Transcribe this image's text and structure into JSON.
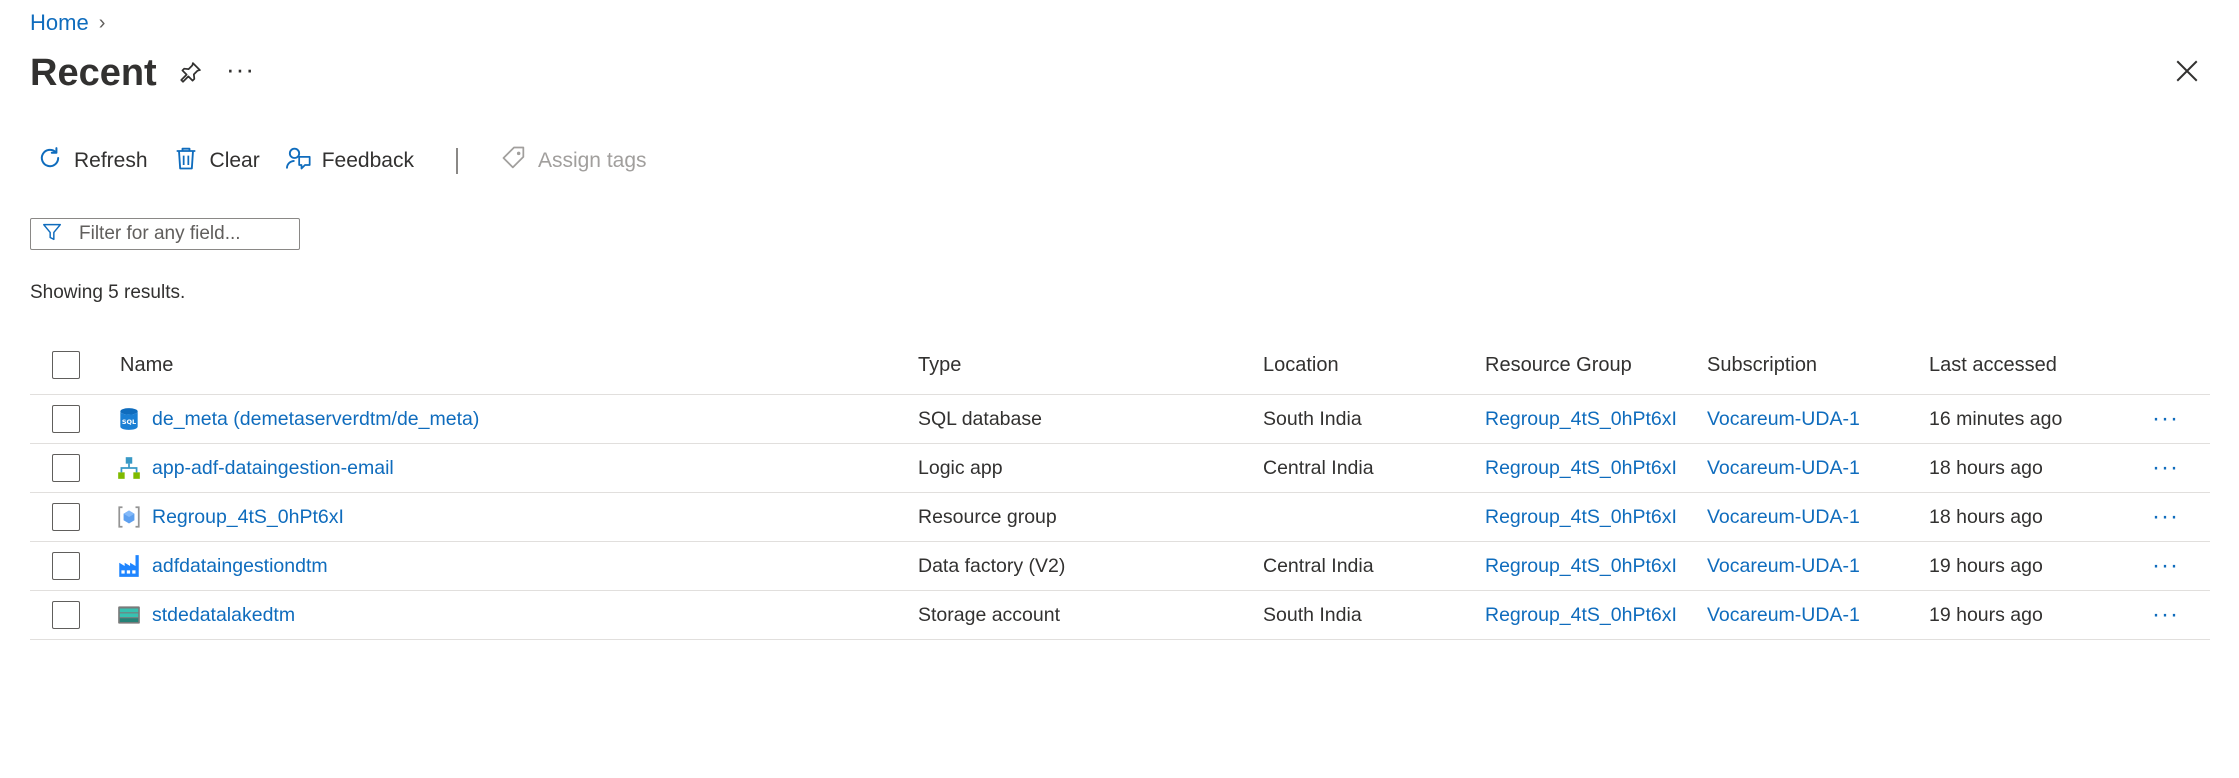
{
  "breadcrumb": {
    "home": "Home",
    "separator": "›"
  },
  "page": {
    "title": "Recent",
    "more": "···"
  },
  "toolbar": {
    "refresh": "Refresh",
    "clear": "Clear",
    "feedback": "Feedback",
    "assign_tags": "Assign tags"
  },
  "filter": {
    "placeholder": "Filter for any field..."
  },
  "results_text": "Showing 5 results.",
  "table": {
    "headers": {
      "name": "Name",
      "type": "Type",
      "location": "Location",
      "resource_group": "Resource Group",
      "subscription": "Subscription",
      "last_accessed": "Last accessed"
    },
    "rows": [
      {
        "icon": "sql-database-icon",
        "name": "de_meta (demetaserverdtm/de_meta)",
        "type": "SQL database",
        "location": "South India",
        "resource_group": "Regroup_4tS_0hPt6xI",
        "subscription": "Vocareum-UDA-1",
        "last_accessed": "16 minutes ago",
        "more": "···"
      },
      {
        "icon": "logic-app-icon",
        "name": "app-adf-dataingestion-email",
        "type": "Logic app",
        "location": "Central India",
        "resource_group": "Regroup_4tS_0hPt6xI",
        "subscription": "Vocareum-UDA-1",
        "last_accessed": "18 hours ago",
        "more": "···"
      },
      {
        "icon": "resource-group-icon",
        "name": "Regroup_4tS_0hPt6xI",
        "type": "Resource group",
        "location": "",
        "resource_group": "Regroup_4tS_0hPt6xI",
        "subscription": "Vocareum-UDA-1",
        "last_accessed": "18 hours ago",
        "more": "···"
      },
      {
        "icon": "data-factory-icon",
        "name": "adfdataingestiondtm",
        "type": "Data factory (V2)",
        "location": "Central India",
        "resource_group": "Regroup_4tS_0hPt6xI",
        "subscription": "Vocareum-UDA-1",
        "last_accessed": "19 hours ago",
        "more": "···"
      },
      {
        "icon": "storage-account-icon",
        "name": "stdedatalakedtm",
        "type": "Storage account",
        "location": "South India",
        "resource_group": "Regroup_4tS_0hPt6xI",
        "subscription": "Vocareum-UDA-1",
        "last_accessed": "19 hours ago",
        "more": "···"
      }
    ]
  },
  "colors": {
    "link": "#0f6cbd",
    "text": "#323130",
    "border": "#e1dfdd",
    "disabled": "#a19f9d"
  }
}
